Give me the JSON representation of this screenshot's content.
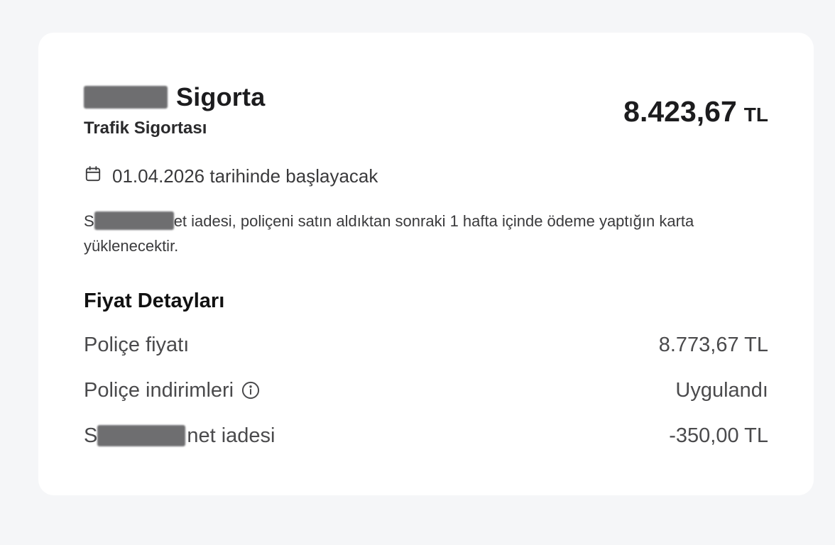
{
  "offer": {
    "company_suffix": "Sigorta",
    "product": "Trafik Sigortası",
    "total_amount": "8.423,67",
    "total_currency": "TL",
    "start_text": "01.04.2026 tarihinde başlayacak",
    "info_lead": "S",
    "info_text": "et iadesi, poliçeni satın aldıktan sonraki 1 hafta içinde ödeme yaptığın karta yüklenecektir.",
    "icons": {
      "calendar": "calendar-icon",
      "info": "info-icon"
    }
  },
  "price_details": {
    "title": "Fiyat Detayları",
    "rows": [
      {
        "label": "Poliçe fiyatı",
        "value": "8.773,67 TL"
      },
      {
        "label": "Poliçe indirimleri",
        "value": "Uygulandı"
      },
      {
        "label_lead": "S",
        "label": "net iadesi",
        "value": "-350,00 TL"
      }
    ]
  }
}
